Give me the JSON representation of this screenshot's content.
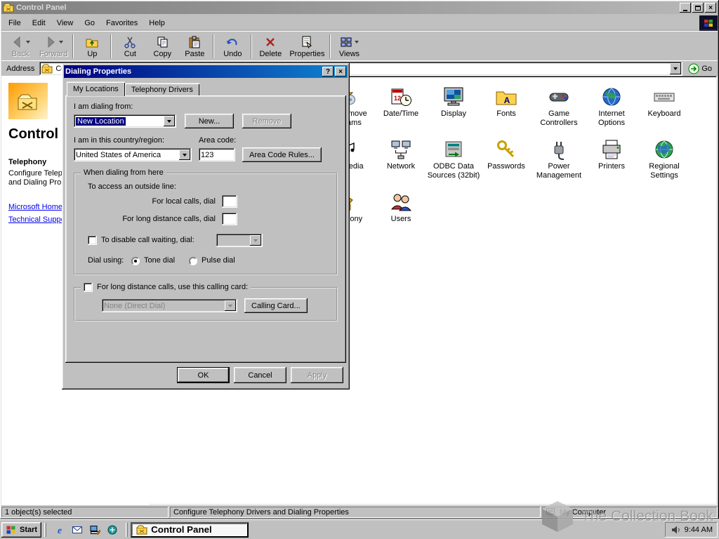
{
  "titlebar": {
    "title": "Control Panel"
  },
  "menu": {
    "items": [
      "File",
      "Edit",
      "View",
      "Go",
      "Favorites",
      "Help"
    ]
  },
  "toolbar": {
    "buttons": [
      {
        "label": "Back",
        "icon": "back-icon",
        "dropdown": true,
        "disabled": true,
        "separator_after": false
      },
      {
        "label": "Forward",
        "icon": "forward-icon",
        "dropdown": true,
        "disabled": true,
        "separator_after": true
      },
      {
        "label": "Up",
        "icon": "up-icon",
        "dropdown": false,
        "disabled": false,
        "separator_after": true
      },
      {
        "label": "Cut",
        "icon": "cut-icon",
        "dropdown": false,
        "disabled": false,
        "separator_after": false
      },
      {
        "label": "Copy",
        "icon": "copy-icon",
        "dropdown": false,
        "disabled": false,
        "separator_after": false
      },
      {
        "label": "Paste",
        "icon": "paste-icon",
        "dropdown": false,
        "disabled": false,
        "separator_after": true
      },
      {
        "label": "Undo",
        "icon": "undo-icon",
        "dropdown": false,
        "disabled": false,
        "separator_after": true
      },
      {
        "label": "Delete",
        "icon": "delete-icon",
        "dropdown": false,
        "disabled": false,
        "separator_after": false
      },
      {
        "label": "Properties",
        "icon": "properties-icon",
        "dropdown": false,
        "disabled": false,
        "separator_after": true
      },
      {
        "label": "Views",
        "icon": "views-icon",
        "dropdown": true,
        "disabled": false,
        "separator_after": false
      }
    ]
  },
  "addressbar": {
    "label": "Address",
    "value": "Control Panel",
    "go_label": "Go"
  },
  "sidebar": {
    "app_title": "Control Panel",
    "selected_name": "Telephony",
    "selected_description": "Configure Telephony Drivers and Dialing Properties",
    "links": [
      {
        "label": "Microsoft Home"
      },
      {
        "label": "Technical Support"
      }
    ]
  },
  "icons": {
    "items": [
      {
        "label": "Add/Remove Programs",
        "icon": "add-remove-programs-icon",
        "col": 0,
        "row": 0
      },
      {
        "label": "Date/Time",
        "icon": "date-time-icon",
        "col": 1,
        "row": 0
      },
      {
        "label": "Display",
        "icon": "display-icon",
        "col": 2,
        "row": 0
      },
      {
        "label": "Fonts",
        "icon": "fonts-icon",
        "col": 3,
        "row": 0
      },
      {
        "label": "Game Controllers",
        "icon": "game-controllers-icon",
        "col": 4,
        "row": 0
      },
      {
        "label": "Internet Options",
        "icon": "internet-options-icon",
        "col": 5,
        "row": 0
      },
      {
        "label": "Keyboard",
        "icon": "keyboard-icon",
        "col": 6,
        "row": 0
      },
      {
        "label": "Multimedia",
        "icon": "multimedia-icon",
        "col": 0,
        "row": 1
      },
      {
        "label": "Network",
        "icon": "network-icon",
        "col": 1,
        "row": 1
      },
      {
        "label": "ODBC Data Sources (32bit)",
        "icon": "odbc-icon",
        "col": 2,
        "row": 1
      },
      {
        "label": "Passwords",
        "icon": "passwords-icon",
        "col": 3,
        "row": 1
      },
      {
        "label": "Power Management",
        "icon": "power-management-icon",
        "col": 4,
        "row": 1
      },
      {
        "label": "Printers",
        "icon": "printers-icon",
        "col": 5,
        "row": 1
      },
      {
        "label": "Regional Settings",
        "icon": "regional-settings-icon",
        "col": 6,
        "row": 1
      },
      {
        "label": "Telephony",
        "icon": "telephony-icon",
        "col": 0,
        "row": 2
      },
      {
        "label": "Users",
        "icon": "users-icon",
        "col": 1,
        "row": 2
      }
    ]
  },
  "dialog": {
    "title": "Dialing Properties",
    "help_button": "?",
    "close_button": "×",
    "tabs": [
      "My Locations",
      "Telephony Drivers"
    ],
    "dialing_from_label": "I am dialing from:",
    "location_value": "New Location",
    "new_button": "New...",
    "remove_button": "Remove",
    "country_label": "I am in this country/region:",
    "country_value": "United States of America",
    "area_code_label": "Area code:",
    "area_code_value": "123",
    "area_code_rules_button": "Area Code Rules...",
    "group_title": "When dialing from here",
    "outside_line_label": "To access an outside line:",
    "local_calls_label": "For local calls, dial",
    "long_distance_label": "For long distance calls, dial",
    "call_waiting_label": "To disable call waiting, dial:",
    "dial_using_label": "Dial using:",
    "tone_dial_label": "Tone dial",
    "pulse_dial_label": "Pulse dial",
    "calling_card_label": "For long distance calls, use this calling card:",
    "calling_card_value": "None (Direct Dial)",
    "calling_card_button": "Calling Card...",
    "ok_button": "OK",
    "cancel_button": "Cancel",
    "apply_button": "Apply"
  },
  "statusbar": {
    "objects": "1 object(s) selected",
    "description": "Configure Telephony Drivers and Dialing Properties",
    "zone": "My Computer"
  },
  "taskbar": {
    "start_label": "Start",
    "quick_launch": [
      "ie-icon",
      "outlook-icon",
      "desktop-icon",
      "channels-icon"
    ],
    "task_label": "Control Panel",
    "tray_time": "9:44 AM"
  },
  "watermark": {
    "text": "The Collection Book"
  },
  "colors": {
    "selection": "#000080",
    "titlebar_active_start": "#000080",
    "titlebar_active_end": "#1084d0"
  }
}
